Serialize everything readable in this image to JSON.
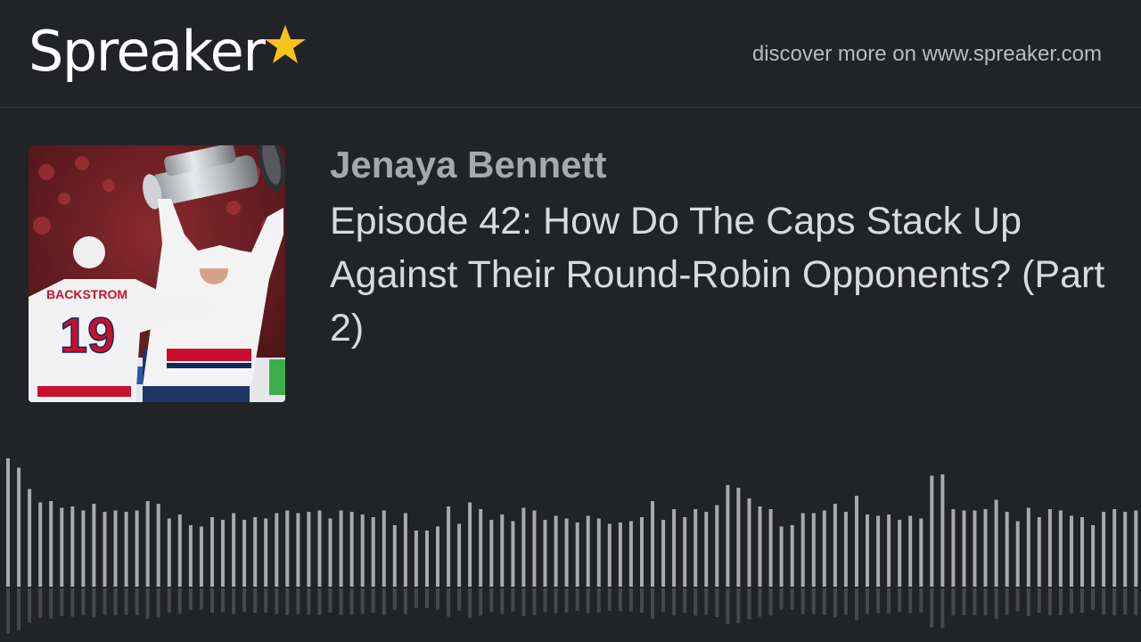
{
  "header": {
    "logo_text": "Spreaker",
    "discover_text": "discover more on www.spreaker.com"
  },
  "episode": {
    "author": "Jenaya Bennett",
    "title": "Episode 42: How Do The Caps Stack Up Against Their Round-Robin Opponents? (Part 2)"
  },
  "cover": {
    "jersey_name": "BACKSTROM",
    "jersey_number": "19"
  },
  "colors": {
    "background": "#222327",
    "accent_star": "#f7c21b",
    "wave_bar": "#a9aaad"
  },
  "waveform": {
    "levels": [
      0.96,
      0.89,
      0.73,
      0.63,
      0.64,
      0.59,
      0.6,
      0.57,
      0.62,
      0.56,
      0.57,
      0.56,
      0.57,
      0.64,
      0.62,
      0.51,
      0.54,
      0.46,
      0.45,
      0.52,
      0.5,
      0.55,
      0.5,
      0.52,
      0.51,
      0.55,
      0.57,
      0.55,
      0.56,
      0.57,
      0.51,
      0.57,
      0.56,
      0.54,
      0.52,
      0.57,
      0.46,
      0.55,
      0.42,
      0.42,
      0.45,
      0.6,
      0.47,
      0.63,
      0.58,
      0.5,
      0.54,
      0.49,
      0.59,
      0.57,
      0.5,
      0.53,
      0.51,
      0.48,
      0.53,
      0.51,
      0.47,
      0.48,
      0.49,
      0.52,
      0.64,
      0.5,
      0.58,
      0.52,
      0.58,
      0.56,
      0.61,
      0.76,
      0.74,
      0.66,
      0.6,
      0.58,
      0.45,
      0.46,
      0.55,
      0.55,
      0.57,
      0.62,
      0.56,
      0.68,
      0.54,
      0.53,
      0.54,
      0.5,
      0.53,
      0.51,
      0.83,
      0.84,
      0.58,
      0.57,
      0.57,
      0.58,
      0.65,
      0.56,
      0.49,
      0.59,
      0.52,
      0.58,
      0.57,
      0.53,
      0.52,
      0.46,
      0.56,
      0.58,
      0.56,
      0.57,
      0.54
    ]
  }
}
